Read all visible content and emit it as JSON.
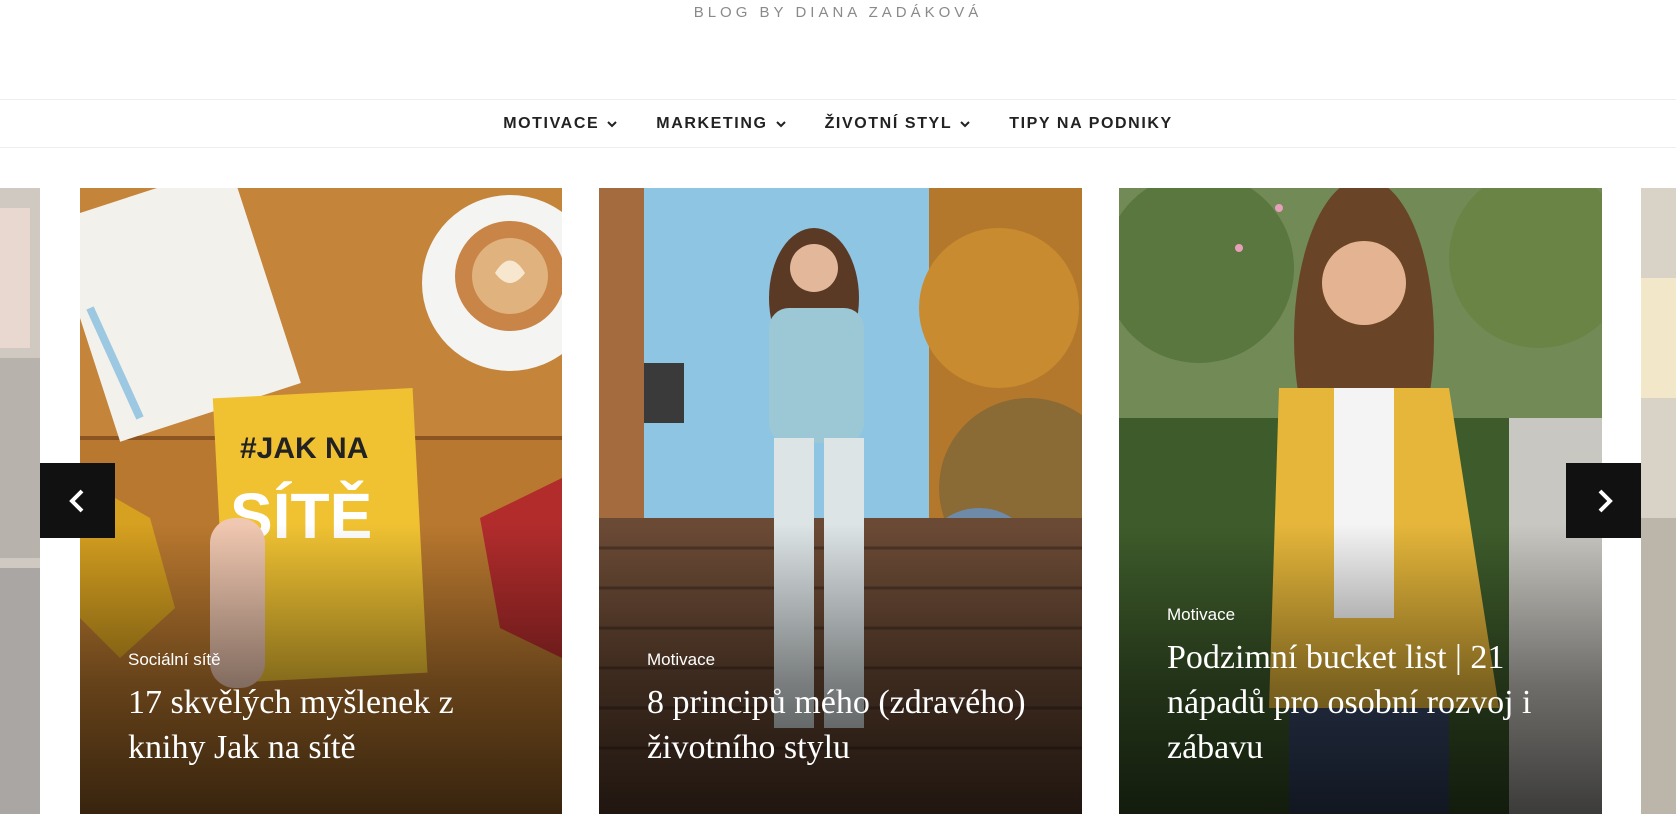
{
  "site": {
    "tagline": "BLOG BY DIANA ZADÁKOVÁ"
  },
  "nav": {
    "items": [
      {
        "label": "MOTIVACE",
        "dropdown": true
      },
      {
        "label": "MARKETING",
        "dropdown": true
      },
      {
        "label": "ŽIVOTNÍ STYL",
        "dropdown": true
      },
      {
        "label": "TIPY NA PODNIKY",
        "dropdown": false
      }
    ]
  },
  "slider": {
    "prev_icon": "chevron-left-icon",
    "next_icon": "chevron-right-icon",
    "posts": [
      {
        "category": "Sociální sítě",
        "title": "17 skvělých myšlenek z knihy Jak na sítě",
        "image": "book-and-coffee-photo"
      },
      {
        "category": "Motivace",
        "title": "8 principů mého (zdravého) životního stylu",
        "image": "woman-on-stairs-photo"
      },
      {
        "category": "Motivace",
        "title": "Podzimní bucket list | 21 nápadů pro osobní rozvoj i zábavu",
        "image": "woman-yellow-jacket-photo"
      }
    ]
  },
  "book_cover": {
    "hashtag_line": "#JAK NA",
    "title_line": "SÍTĚ"
  },
  "colors": {
    "nav_text": "#222222",
    "arrow_bg": "#111111",
    "tagline": "#8a8a8a"
  }
}
